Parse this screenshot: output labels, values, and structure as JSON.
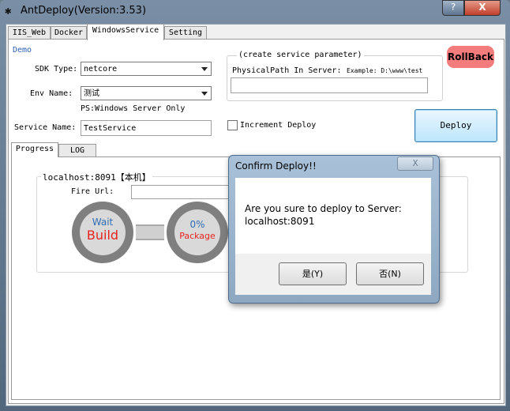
{
  "window": {
    "title": "AntDeploy(Version:3.53)",
    "help_label": "?",
    "close_label": "X"
  },
  "tabs": [
    "IIS_Web",
    "Docker",
    "WindowsService",
    "Setting"
  ],
  "form": {
    "env_group_label": "Demo",
    "sdk_type_label": "SDK Type:",
    "sdk_type_value": "netcore",
    "env_name_label": "Env Name:",
    "env_name_value": "测试",
    "ps_note": "PS:Windows Server Only",
    "service_name_label": "Service Name:",
    "service_name_value": "TestService",
    "group_title": "(create service parameter)",
    "physical_path_label": "PhysicalPath In Server:",
    "physical_path_example": "Example: D:\\www\\test",
    "physical_path_value": "",
    "increment_label": "Increment Deploy",
    "rollback_label": "RollBack",
    "deploy_label": "Deploy"
  },
  "bottom_tabs": [
    "Progress",
    "LOG"
  ],
  "progress": {
    "server_label": "localhost:8091【本机】",
    "fire_url_label": "Fire Url:",
    "fire_url_value": "",
    "step1_status": "Wait",
    "step1_name": "Build",
    "step2_percent": "0%",
    "step2_name": "Package"
  },
  "dialog": {
    "title": "Confirm Deploy!!",
    "close_label": "X",
    "message_line1": "Are you sure to deploy to Server:",
    "message_line2": "localhost:8091",
    "yes_label": "是(Y)",
    "no_label": "否(N)"
  },
  "colors": {
    "rollback_bg": "#f47c7c",
    "build_text": "#e8231e",
    "wait_text": "#2f6db5"
  }
}
